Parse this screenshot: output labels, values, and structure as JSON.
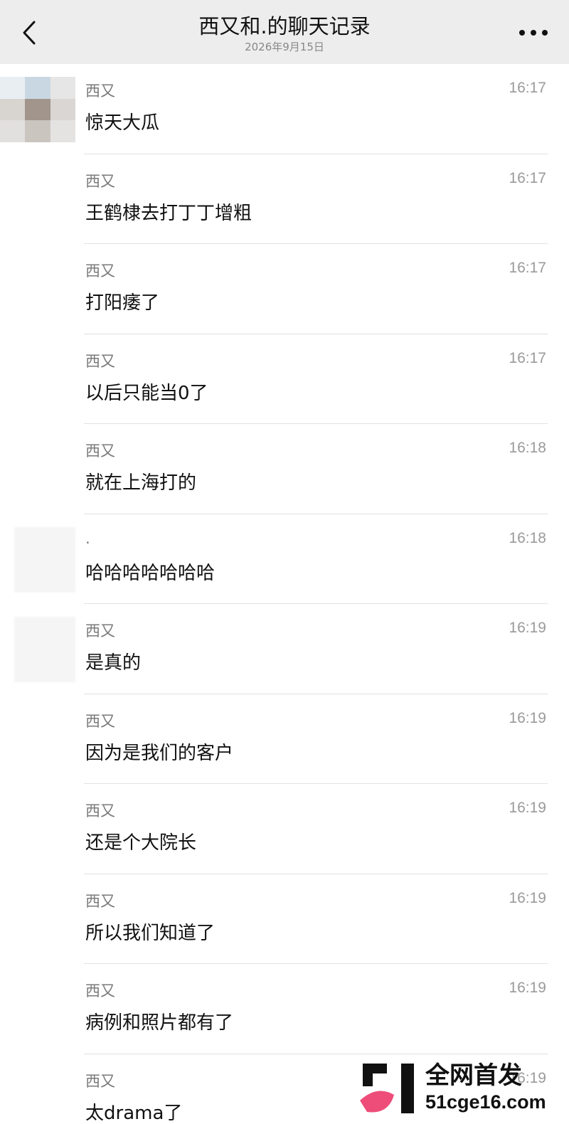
{
  "header": {
    "title": "西又和.的聊天记录",
    "subtitle": "2026年9月15日",
    "back_icon": "chevron-left-icon",
    "more_icon": "more-dots-icon"
  },
  "messages": [
    {
      "sender": "西又",
      "time": "16:17",
      "text": "惊天大瓜",
      "avatar": "pixel"
    },
    {
      "sender": "西又",
      "time": "16:17",
      "text": "王鹤棣去打丁丁增粗",
      "avatar": "none"
    },
    {
      "sender": "西又",
      "time": "16:17",
      "text": "打阳痿了",
      "avatar": "none"
    },
    {
      "sender": "西又",
      "time": "16:17",
      "text": "以后只能当0了",
      "avatar": "none"
    },
    {
      "sender": "西又",
      "time": "16:18",
      "text": "就在上海打的",
      "avatar": "none"
    },
    {
      "sender": ".",
      "time": "16:18",
      "text": "哈哈哈哈哈哈哈",
      "avatar": "faint"
    },
    {
      "sender": "西又",
      "time": "16:19",
      "text": "是真的",
      "avatar": "faint"
    },
    {
      "sender": "西又",
      "time": "16:19",
      "text": "因为是我们的客户",
      "avatar": "none"
    },
    {
      "sender": "西又",
      "time": "16:19",
      "text": "还是个大院长",
      "avatar": "none"
    },
    {
      "sender": "西又",
      "time": "16:19",
      "text": "所以我们知道了",
      "avatar": "none"
    },
    {
      "sender": "西又",
      "time": "16:19",
      "text": "病例和照片都有了",
      "avatar": "none"
    },
    {
      "sender": "西又",
      "time": "16:19",
      "text": "太drama了",
      "avatar": "none"
    }
  ],
  "watermark": {
    "line1": "全网首发",
    "line2": "51cge16.com"
  },
  "colors": {
    "header_bg": "#ededed",
    "divider": "#e2e2e2",
    "meta_text": "#7a7a7a",
    "watermark_pink": "#ee4d7a"
  }
}
